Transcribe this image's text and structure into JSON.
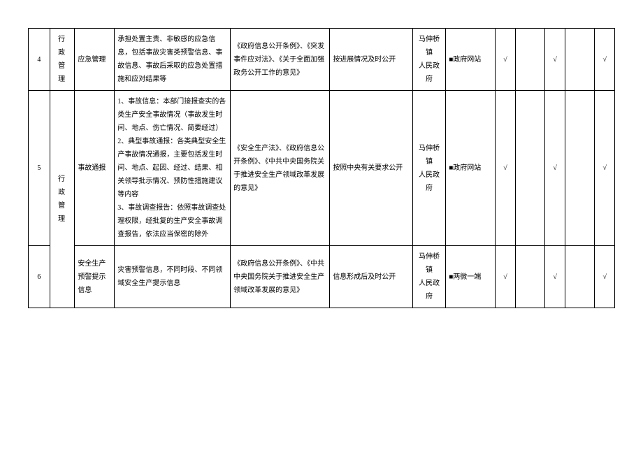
{
  "rows": [
    {
      "num": "4",
      "category": "行 政\n管 理",
      "item": "应急管理",
      "content": "承担处置主责、非敏感的应急信息，包括事故灾害类预警信息、事故信息、事故后采取的应急处置措施和应对结果等",
      "basis": "《政府信息公开条例》、《突发事件应对法》、《关于全面加强政务公开工作的意见》",
      "timing": "按进展情况及时公开",
      "org": "马伸桥镇\n人民政府",
      "channel": "■政府网站",
      "c1": "√",
      "c2": "",
      "c3": "√",
      "c4": "",
      "c5": "√"
    },
    {
      "num": "5",
      "category": "行 政\n管 理",
      "item": "事故通报",
      "content": "1、事故信息：本部门接报查实的各类生产安全事故情况（事故发生时间、地点、伤亡情况、简要经过）\n2、典型事故通报：各类典型安全生产事故情况通报，主要包括发生时间、地点、起因、经过、结果、相关领导批示情况、预防性措施建议等内容\n3、事故调查报告：依照事故调查处理权限，经批复的生产安全事故调查报告，依法应当保密的除外",
      "basis": "《安全生产法》、《政府信息公开条例》、《中共中央国务院关于推进安全生产领域改革发展的意见》",
      "timing": "按照中央有关要求公开",
      "org": "马伸桥镇\n人民政府",
      "channel": "■政府网站",
      "c1": "√",
      "c2": "",
      "c3": "√",
      "c4": "",
      "c5": "√"
    },
    {
      "num": "6",
      "category": "",
      "item": "安全生产\n预警提示\n信息",
      "content": "灾害预警信息，不同时段、不同领域安全生产提示信息",
      "basis": "《政府信息公开条例》、《中共中央国务院关于推进安全生产领域改革发展的意见》",
      "timing": "信息形成后及时公开",
      "org": "马伸桥镇\n人民政府",
      "channel": "■两微一端",
      "c1": "√",
      "c2": "",
      "c3": "√",
      "c4": "",
      "c5": "√"
    }
  ]
}
